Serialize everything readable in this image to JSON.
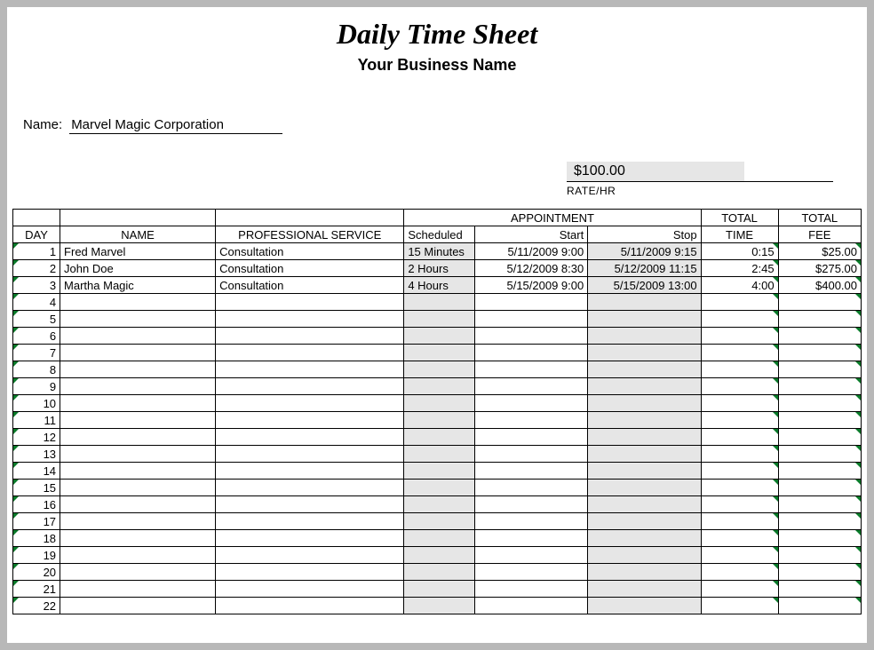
{
  "title": "Daily Time Sheet",
  "subtitle": "Your Business Name",
  "name_label": "Name:",
  "name_value": "Marvel Magic Corporation",
  "rate": {
    "value": "$100.00",
    "label": "RATE/HR"
  },
  "headers": {
    "appointment": "APPOINTMENT",
    "total_top": "TOTAL",
    "day": "DAY",
    "name": "NAME",
    "service": "PROFESSIONAL SERVICE",
    "scheduled": "Scheduled",
    "start": "Start",
    "stop": "Stop",
    "time": "TIME",
    "fee": "FEE"
  },
  "row_count": 22,
  "rows": [
    {
      "day": "1",
      "name": "Fred Marvel",
      "service": "Consultation",
      "scheduled": "15 Minutes",
      "start": "5/11/2009 9:00",
      "stop": "5/11/2009 9:15",
      "time": "0:15",
      "fee": "$25.00"
    },
    {
      "day": "2",
      "name": "John Doe",
      "service": "Consultation",
      "scheduled": "2 Hours",
      "start": "5/12/2009 8:30",
      "stop": "5/12/2009 11:15",
      "time": "2:45",
      "fee": "$275.00"
    },
    {
      "day": "3",
      "name": "Martha Magic",
      "service": "Consultation",
      "scheduled": "4 Hours",
      "start": "5/15/2009 9:00",
      "stop": "5/15/2009 13:00",
      "time": "4:00",
      "fee": "$400.00"
    }
  ]
}
